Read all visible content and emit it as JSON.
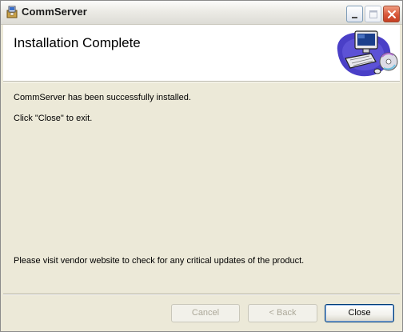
{
  "window": {
    "title": "CommServer",
    "icon": "installer-icon",
    "controls": {
      "minimize": "minimize-icon",
      "maximize": "maximize-icon",
      "close": "close-icon"
    }
  },
  "banner": {
    "title": "Installation Complete",
    "art": "computer-with-cd-illustration"
  },
  "body": {
    "line1": "CommServer has been successfully installed.",
    "line2": "Click \"Close\" to exit.",
    "footer_note": "Please  visit vendor website to check for any critical updates of the product."
  },
  "buttons": {
    "cancel": "Cancel",
    "back": "< Back",
    "close": "Close"
  },
  "colors": {
    "dialog_bg": "#ece9d8",
    "close_titlebar_button": "#d9573a",
    "default_button_border": "#003c74"
  }
}
